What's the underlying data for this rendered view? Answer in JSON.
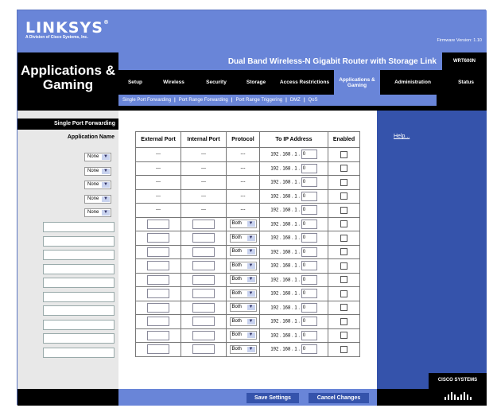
{
  "header": {
    "logo": "LINKSYS",
    "logo_registered": "®",
    "logo_sub": "A Division of Cisco Systems, Inc.",
    "firmware": "Firmware Version: 1.10"
  },
  "title": "Applications & Gaming",
  "product": {
    "name": "Dual Band Wireless-N Gigabit Router with Storage Link",
    "model": "WRT600N"
  },
  "tabs": [
    "Setup",
    "Wireless",
    "Security",
    "Storage",
    "Access Restrictions",
    "Applications & Gaming",
    "Administration",
    "Status"
  ],
  "subtabs": [
    "Single Port Forwarding",
    "Port Range Forwarding",
    "Port Range Triggering",
    "DMZ",
    "QoS"
  ],
  "subtab_separator": "|",
  "section_title": "Single Port Forwarding",
  "app_name_header": "Application Name",
  "columns": [
    "External Port",
    "Internal Port",
    "Protocol",
    "To IP Address",
    "Enabled"
  ],
  "preset_rows": [
    {
      "app": "None",
      "ext": "---",
      "int": "---",
      "proto": "---",
      "ip_prefix": "192 . 168 . 1 .",
      "last_octet": "0"
    },
    {
      "app": "None",
      "ext": "---",
      "int": "---",
      "proto": "---",
      "ip_prefix": "192 . 168 . 1 .",
      "last_octet": "0"
    },
    {
      "app": "None",
      "ext": "---",
      "int": "---",
      "proto": "---",
      "ip_prefix": "192 . 168 . 1 .",
      "last_octet": "0"
    },
    {
      "app": "None",
      "ext": "---",
      "int": "---",
      "proto": "---",
      "ip_prefix": "192 . 168 . 1 .",
      "last_octet": "0"
    },
    {
      "app": "None",
      "ext": "---",
      "int": "---",
      "proto": "---",
      "ip_prefix": "192 . 168 . 1 .",
      "last_octet": "0"
    }
  ],
  "custom_rows": [
    {
      "proto": "Both",
      "ip_prefix": "192 . 168 . 1 .",
      "last_octet": "0"
    },
    {
      "proto": "Both",
      "ip_prefix": "192 . 168 . 1 .",
      "last_octet": "0"
    },
    {
      "proto": "Both",
      "ip_prefix": "192 . 168 . 1 .",
      "last_octet": "0"
    },
    {
      "proto": "Both",
      "ip_prefix": "192 . 168 . 1 .",
      "last_octet": "0"
    },
    {
      "proto": "Both",
      "ip_prefix": "192 . 168 . 1 .",
      "last_octet": "0"
    },
    {
      "proto": "Both",
      "ip_prefix": "192 . 168 . 1 .",
      "last_octet": "0"
    },
    {
      "proto": "Both",
      "ip_prefix": "192 . 168 . 1 .",
      "last_octet": "0"
    },
    {
      "proto": "Both",
      "ip_prefix": "192 . 168 . 1 .",
      "last_octet": "0"
    },
    {
      "proto": "Both",
      "ip_prefix": "192 . 168 . 1 .",
      "last_octet": "0"
    },
    {
      "proto": "Both",
      "ip_prefix": "192 . 168 . 1 .",
      "last_octet": "0"
    }
  ],
  "help": "Help...",
  "buttons": {
    "save": "Save Settings",
    "cancel": "Cancel Changes"
  },
  "cisco": "CISCO SYSTEMS",
  "colors": {
    "accent": "#6985d8",
    "sidebar_blue": "#3553ab",
    "black": "#000000"
  }
}
